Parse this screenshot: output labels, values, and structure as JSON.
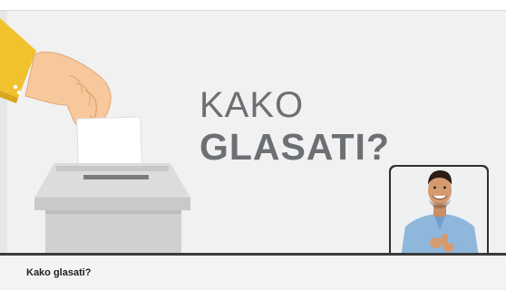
{
  "video": {
    "title_line1": "KAKO",
    "title_line2": "GLASATI?"
  },
  "caption": {
    "text": "Kako glasati?"
  },
  "colors": {
    "title_text": "#6c6f73",
    "sleeve": "#f2c12e",
    "skin": "#f7c89b",
    "ballot_box": "#cfcfcf",
    "signer_frame": "#2f2f2f",
    "background": "#f1f1f1"
  },
  "icons": [
    "hand-illustration",
    "ballot-box-illustration",
    "sign-language-interpreter"
  ]
}
